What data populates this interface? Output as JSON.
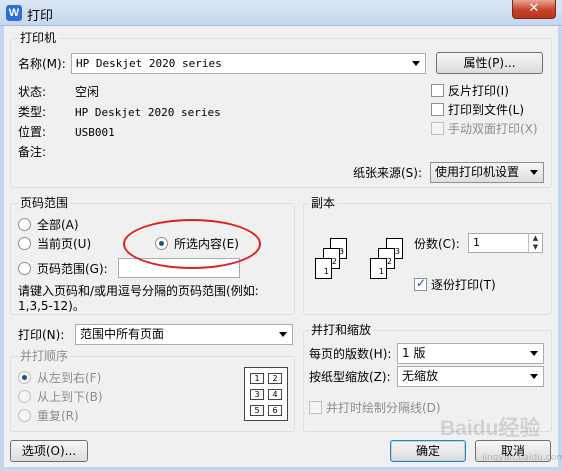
{
  "window": {
    "title": "打印",
    "icon_letter": "W",
    "close_glyph": "✕"
  },
  "printer": {
    "group_label": "打印机",
    "name_label": "名称(M):",
    "name_value": "HP Deskjet 2020 series",
    "properties_button": "属性(P)...",
    "status_label": "状态:",
    "status_value": "空闲",
    "type_label": "类型:",
    "type_value": "HP Deskjet 2020 series",
    "location_label": "位置:",
    "location_value": "USB001",
    "comment_label": "备注:",
    "reverse_print": "反片打印(I)",
    "print_to_file": "打印到文件(L)",
    "manual_duplex": "手动双面打印(X)",
    "paper_source_label": "纸张来源(S):",
    "paper_source_value": "使用打印机设置"
  },
  "page_range": {
    "group_label": "页码范围",
    "all": "全部(A)",
    "current_page": "当前页(U)",
    "selection": "所选内容(E)",
    "pages": "页码范围(G):",
    "hint": "请键入页码和/或用逗号分隔的页码范围(例如:",
    "hint_example": "1,3,5-12)。",
    "selected_option": "selection"
  },
  "copies": {
    "group_label": "副本",
    "count_label": "份数(C):",
    "count_value": "1",
    "collate": "逐份打印(T)",
    "collate_checked": true
  },
  "print_what": {
    "label": "打印(N):",
    "value": "范围中所有页面"
  },
  "order": {
    "group_label": "并打顺序",
    "left_to_right": "从左到右(F)",
    "top_to_bottom": "从上到下(B)",
    "repeat": "重复(R)",
    "grid_numbers": [
      "1",
      "2",
      "3",
      "4",
      "5",
      "6"
    ]
  },
  "zoom": {
    "group_label": "并打和缩放",
    "pages_per_sheet_label": "每页的版数(H):",
    "pages_per_sheet_value": "1 版",
    "scale_label": "按纸型缩放(Z):",
    "scale_value": "无缩放",
    "draw_borders": "并打时绘制分隔线(D)"
  },
  "footer": {
    "options_button": "选项(O)...",
    "ok_button": "确定",
    "cancel_button": "取消"
  },
  "annotation": {
    "highlight_color": "#e02020"
  },
  "watermark": {
    "text": "Baidu经验",
    "small": "jingyan.baidu.com"
  }
}
